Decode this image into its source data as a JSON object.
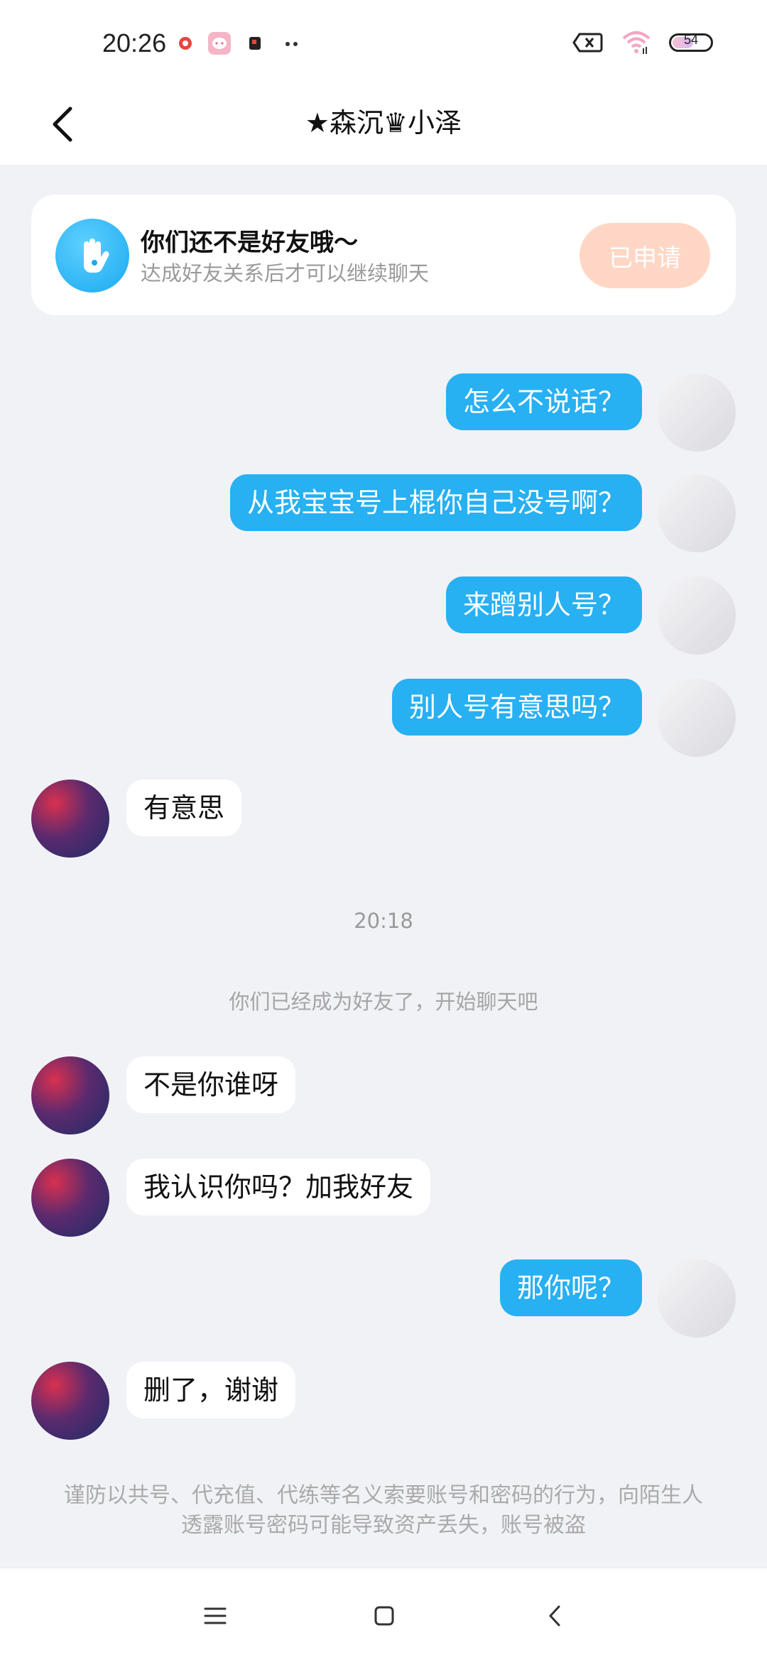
{
  "status_bar": {
    "time": "20:26",
    "battery": "54"
  },
  "header": {
    "title": "★森沉♛小泽"
  },
  "notice": {
    "title": "你们还不是好友哦～",
    "subtitle": "达成好友关系后才可以继续聊天",
    "button_label": "已申请"
  },
  "messages": [
    {
      "side": "out",
      "text": "怎么不说话？"
    },
    {
      "side": "out",
      "text": "从我宝宝号上棍你自己没号啊？"
    },
    {
      "side": "out",
      "text": "来蹭别人号？"
    },
    {
      "side": "out",
      "text": "别人号有意思吗？"
    },
    {
      "side": "in",
      "text": "有意思"
    },
    {
      "side": "in",
      "text": "不是你谁呀"
    },
    {
      "side": "in",
      "text": "我认识你吗？加我好友"
    },
    {
      "side": "out",
      "text": "那你呢？"
    },
    {
      "side": "in",
      "text": "删了，谢谢"
    }
  ],
  "timestamp": "20:18",
  "system_note": "你们已经成为好友了，开始聊天吧",
  "warning": "谨防以共号、代充值、代练等名义索要账号和密码的行为，向陌生人透露账号密码可能导致资产丢失，账号被盗",
  "icons": {
    "back": "back-arrow-icon",
    "notice_avatar": "hand-wave-icon",
    "nav_menu": "menu-icon",
    "nav_home": "home-square-icon",
    "nav_back": "back-chevron-icon"
  },
  "colors": {
    "outgoing_bubble": "#27b0f2",
    "applied_button": "#ffd7c4",
    "background": "#f1f2f6"
  }
}
